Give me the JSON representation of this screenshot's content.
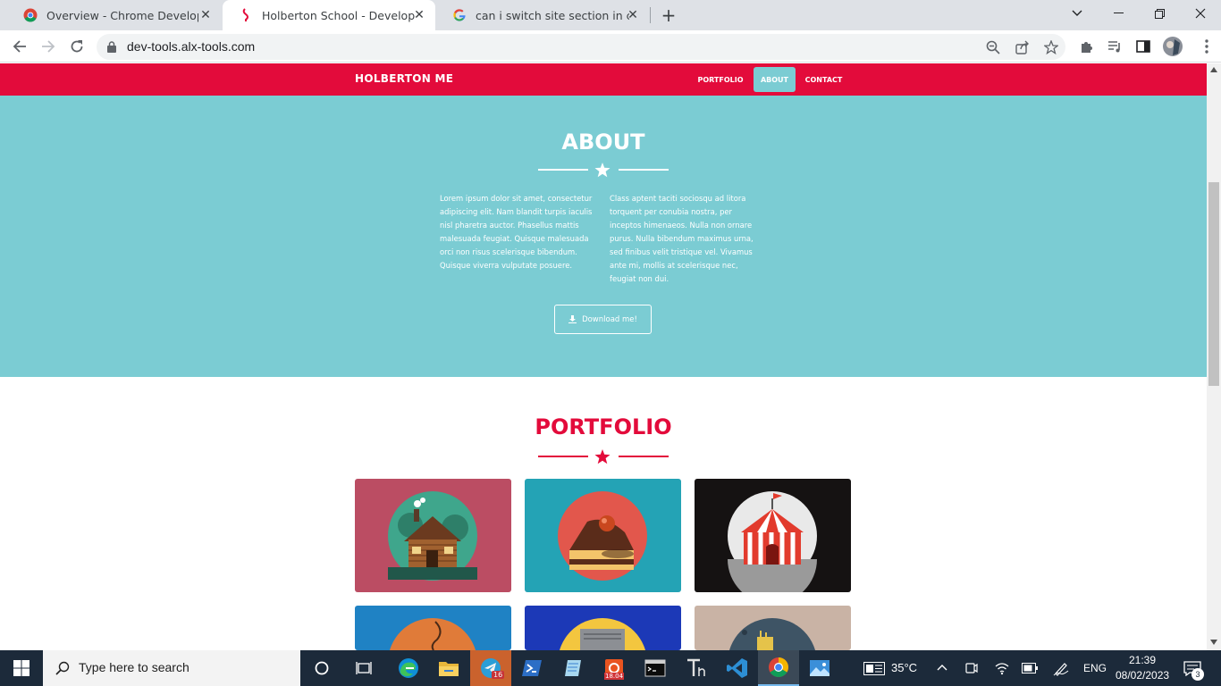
{
  "browser": {
    "tabs": [
      {
        "title": "Overview - Chrome Developers",
        "active": false,
        "icon": "chrome-icon"
      },
      {
        "title": "Holberton School - Developer to",
        "active": true,
        "icon": "holberton-icon"
      },
      {
        "title": "can i switch site section in chrom",
        "active": false,
        "icon": "google-icon"
      }
    ],
    "new_tab_label": "+",
    "url": "dev-tools.alx-tools.com"
  },
  "site": {
    "brand": "HOLBERTON ME",
    "nav": [
      {
        "label": "PORTFOLIO",
        "active": false
      },
      {
        "label": "ABOUT",
        "active": true
      },
      {
        "label": "CONTACT",
        "active": false
      }
    ],
    "about": {
      "title": "ABOUT",
      "col1": "Lorem ipsum dolor sit amet, consectetur adipiscing elit. Nam blandit turpis iaculis nisl pharetra auctor. Phasellus mattis malesuada feugiat. Quisque malesuada orci non risus scelerisque bibendum. Quisque viverra vulputate posuere.",
      "col2": "Class aptent taciti sociosqu ad litora torquent per conubia nostra, per inceptos himenaeos. Nulla non ornare purus. Nulla bibendum maximus urna, sed finibus velit tristique vel. Vivamus ante mi, mollis at scelerisque nec, feugiat non dui.",
      "download_label": "Download me!"
    },
    "portfolio": {
      "title": "PORTFOLIO"
    }
  },
  "taskbar": {
    "search_placeholder": "Type here to search",
    "telegram_badge": "16",
    "ubuntu_badge": "18.04",
    "weather": "35°C",
    "language": "ENG",
    "time": "21:39",
    "date": "08/02/2023",
    "notifications": "3"
  },
  "colors": {
    "brand_red": "#e30b3b",
    "about_teal": "#7bccd3",
    "taskbar": "#1c2a3a"
  }
}
